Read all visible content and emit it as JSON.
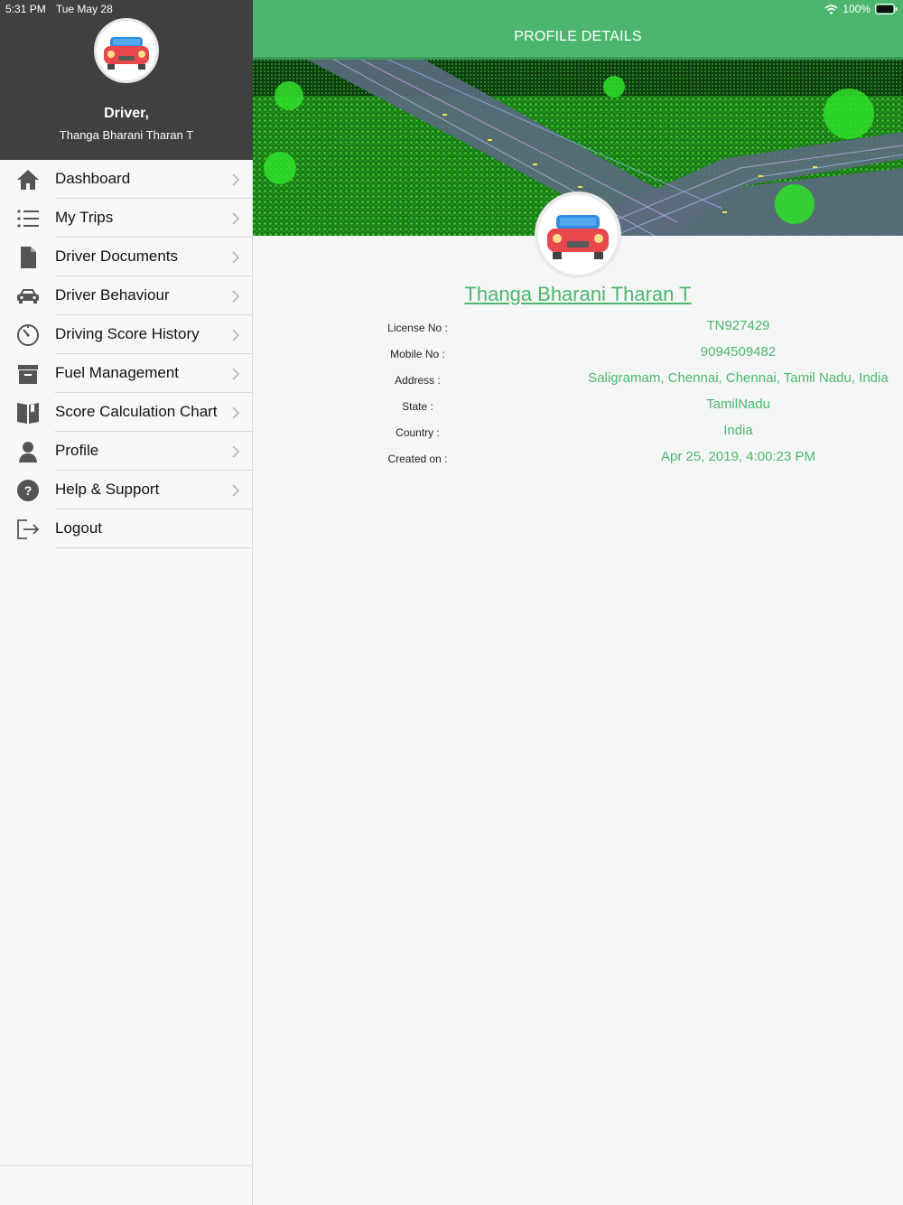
{
  "status_bar": {
    "time": "5:31 PM",
    "date": "Tue May 28",
    "battery": "100%"
  },
  "sidebar": {
    "driver_label": "Driver,",
    "driver_name": "Thanga Bharani Tharan T",
    "items": [
      {
        "label": "Dashboard",
        "icon": "home-icon"
      },
      {
        "label": "My Trips",
        "icon": "list-icon"
      },
      {
        "label": "Driver Documents",
        "icon": "document-icon"
      },
      {
        "label": "Driver Behaviour",
        "icon": "car-icon"
      },
      {
        "label": "Driving Score History",
        "icon": "timer-icon"
      },
      {
        "label": "Fuel Management",
        "icon": "archive-icon"
      },
      {
        "label": "Score Calculation Chart",
        "icon": "book-icon"
      },
      {
        "label": "Profile",
        "icon": "person-icon"
      },
      {
        "label": "Help & Support",
        "icon": "help-icon"
      },
      {
        "label": "Logout",
        "icon": "logout-icon"
      }
    ]
  },
  "header": {
    "title": "PROFILE DETAILS"
  },
  "profile": {
    "name": "Thanga Bharani Tharan T",
    "fields": [
      {
        "label": "License No :",
        "value": "TN927429"
      },
      {
        "label": "Mobile No :",
        "value": "9094509482"
      },
      {
        "label": "Address :",
        "value": "Saligramam, Chennai, Chennai, Tamil Nadu, India"
      },
      {
        "label": "State :",
        "value": "TamilNadu"
      },
      {
        "label": "Country :",
        "value": "India"
      },
      {
        "label": "Created on :",
        "value": "Apr 25, 2019, 4:00:23 PM"
      }
    ]
  },
  "colors": {
    "accent": "#4cb66f",
    "sidebar_header": "#404040",
    "background": "#f5f7f6"
  }
}
